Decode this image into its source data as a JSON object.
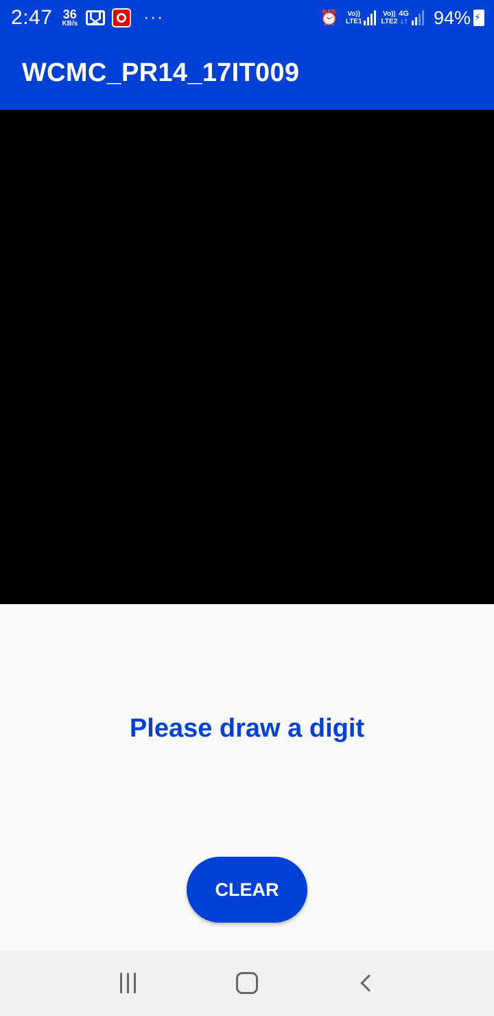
{
  "status_bar": {
    "time": "2:47",
    "speed_value": "36",
    "speed_unit": "KB/s",
    "more": "···",
    "sim1_top": "Vo))",
    "sim1_bottom": "LTE1",
    "sim2_top": "Vo))",
    "sim2_bottom": "LTE2",
    "data_type": "4G",
    "data_arrows": "↓↑",
    "battery_percent": "94%",
    "icons": [
      "gmail-icon",
      "vodafone-icon",
      "alarm-icon",
      "signal-icon",
      "battery-charging-icon"
    ]
  },
  "app_bar": {
    "title": "WCMC_PR14_17IT009"
  },
  "main": {
    "prompt": "Please draw a digit",
    "clear_label": "CLEAR"
  },
  "colors": {
    "primary": "#0241d6",
    "canvas": "#000000",
    "background": "#f9f9f9"
  },
  "nav_bar": {
    "icons": [
      "recents-icon",
      "home-icon",
      "back-icon"
    ]
  }
}
